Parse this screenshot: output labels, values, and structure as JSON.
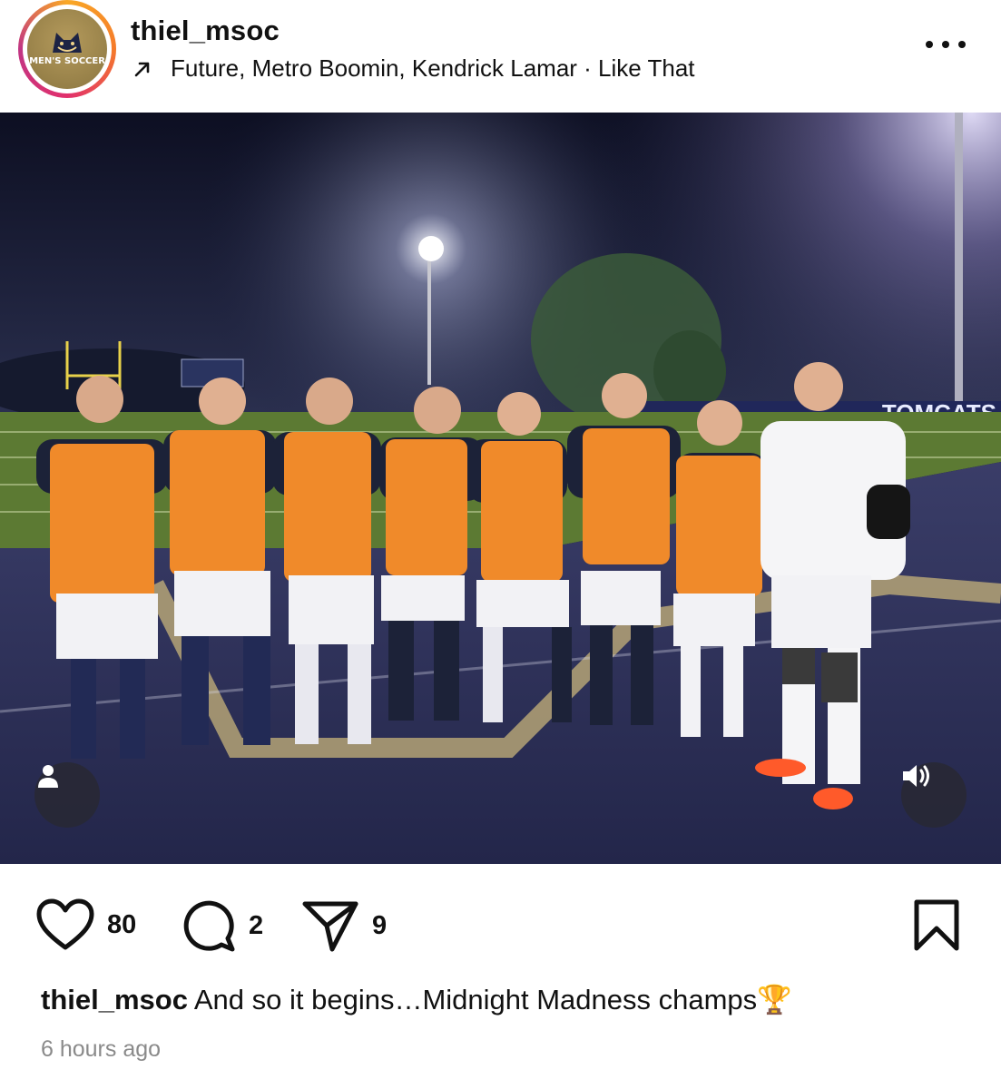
{
  "header": {
    "username": "thiel_msoc",
    "avatar_text": "MEN'S SOCCER",
    "music": "Future, Metro Boomin, Kendrick Lamar · Like That",
    "music_icon": "arrow-up-right-icon",
    "more_icon": "more-options-icon"
  },
  "photo": {
    "banner_text": "TOMCATS",
    "user_tag_icon": "user-tag-icon",
    "sound_icon": "sound-on-icon"
  },
  "actions": {
    "likes": "80",
    "comments": "2",
    "shares": "9",
    "like_icon": "heart-icon",
    "comment_icon": "comment-icon",
    "share_icon": "paper-plane-icon",
    "save_icon": "bookmark-icon"
  },
  "caption": {
    "username": "thiel_msoc",
    "text": "And so it begins…Midnight Madness champs🏆"
  },
  "timestamp": "6 hours ago",
  "colors": {
    "ring_start": "#f9a826",
    "ring_end": "#c13584",
    "bib": "#f08a2a",
    "turf": "#2c2f57",
    "field_grass": "#5c7a33"
  }
}
